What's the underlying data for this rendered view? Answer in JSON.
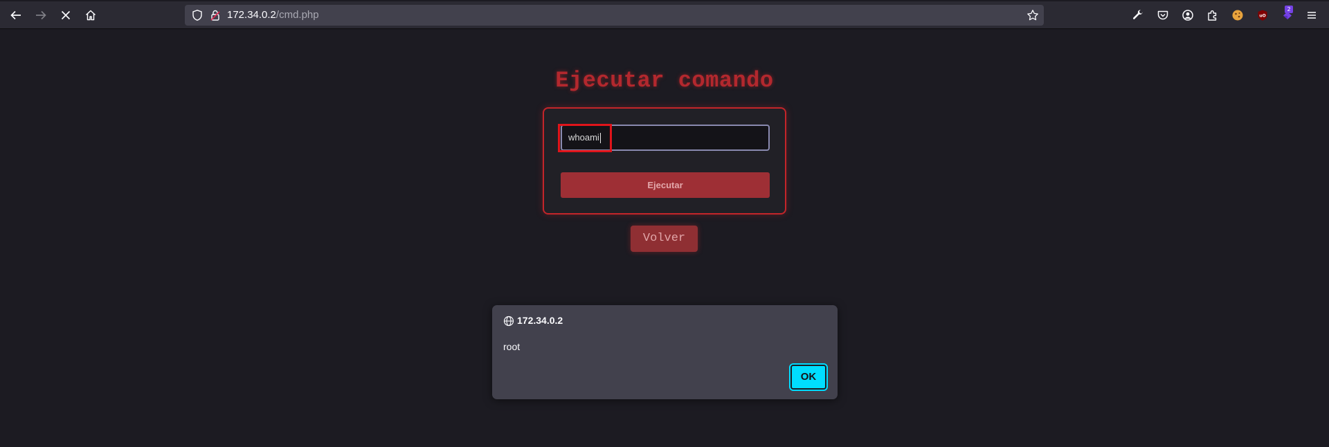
{
  "browser": {
    "url_host": "172.34.0.2",
    "url_path": "/cmd.php",
    "extension_badge_count": "2",
    "icons": [
      "back-icon",
      "forward-icon",
      "stop-icon",
      "home-icon",
      "shield-icon",
      "lock-icon",
      "bookmark-star-icon",
      "wrench-icon",
      "pocket-icon",
      "account-icon",
      "extensions-icon",
      "cookie-extension-icon",
      "ublock-icon",
      "extension-badge-icon",
      "menu-icon"
    ],
    "ublock_label": "uO"
  },
  "page": {
    "title": "Ejecutar comando",
    "command_input_value": "whoami",
    "execute_button_label": "Ejecutar",
    "back_button_label": "Volver",
    "accent_color": "#b3282e"
  },
  "dialog": {
    "origin": "172.34.0.2",
    "message": "root",
    "ok_label": "OK",
    "ok_color": "#00ddff"
  }
}
